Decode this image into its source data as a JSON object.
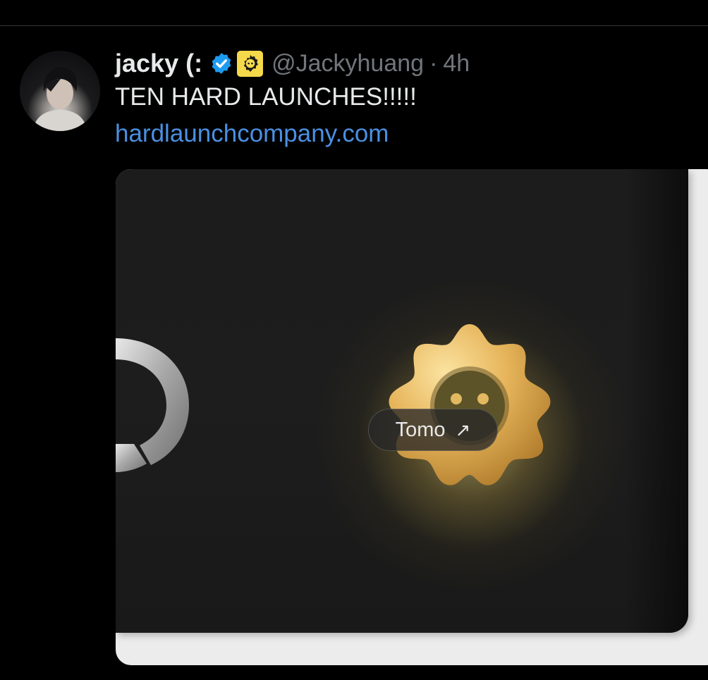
{
  "tweet": {
    "display_name": "jacky (:",
    "handle": "@Jackyhuang",
    "separator": "·",
    "time": "4h",
    "text": "TEN HARD LAUNCHES!!!!!",
    "link": "hardlaunchcompany.com",
    "icons": {
      "verified": "verified-badge-icon",
      "affiliation": "affiliate-badge-icon"
    },
    "colors": {
      "background": "#000000",
      "text": "#e7e9ea",
      "muted": "#71767b",
      "link": "#4a90e2",
      "verified": "#1d9bf0",
      "affiliate_badge": "#f5d94a"
    }
  },
  "media": {
    "chip_label": "Tomo",
    "chip_icon": "arrow-up-right-icon",
    "chip_arrow": "↗"
  }
}
